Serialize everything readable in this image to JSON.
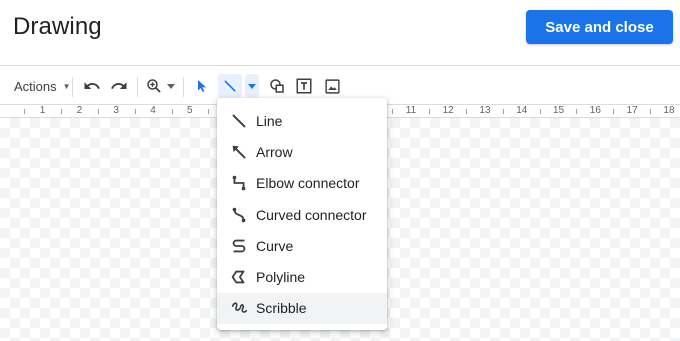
{
  "header": {
    "title": "Drawing",
    "save_label": "Save and close",
    "accent_color": "#1a73e8"
  },
  "toolbar": {
    "actions_label": "Actions",
    "tools": [
      {
        "name": "undo-icon"
      },
      {
        "name": "redo-icon"
      },
      {
        "name": "zoom-icon"
      },
      {
        "name": "select-icon"
      },
      {
        "name": "line-icon"
      },
      {
        "name": "shape-icon"
      },
      {
        "name": "text-box-icon"
      },
      {
        "name": "image-icon"
      }
    ]
  },
  "ruler": {
    "numbers": [
      "1",
      "2",
      "3",
      "4",
      "5",
      "11",
      "12",
      "13",
      "14",
      "15",
      "16",
      "17",
      "18"
    ]
  },
  "line_menu": {
    "items": [
      {
        "label": "Line",
        "icon": "line-icon"
      },
      {
        "label": "Arrow",
        "icon": "arrow-icon"
      },
      {
        "label": "Elbow connector",
        "icon": "elbow-connector-icon"
      },
      {
        "label": "Curved connector",
        "icon": "curved-connector-icon"
      },
      {
        "label": "Curve",
        "icon": "curve-icon"
      },
      {
        "label": "Polyline",
        "icon": "polyline-icon"
      },
      {
        "label": "Scribble",
        "icon": "scribble-icon"
      }
    ],
    "highlighted": "Scribble"
  }
}
